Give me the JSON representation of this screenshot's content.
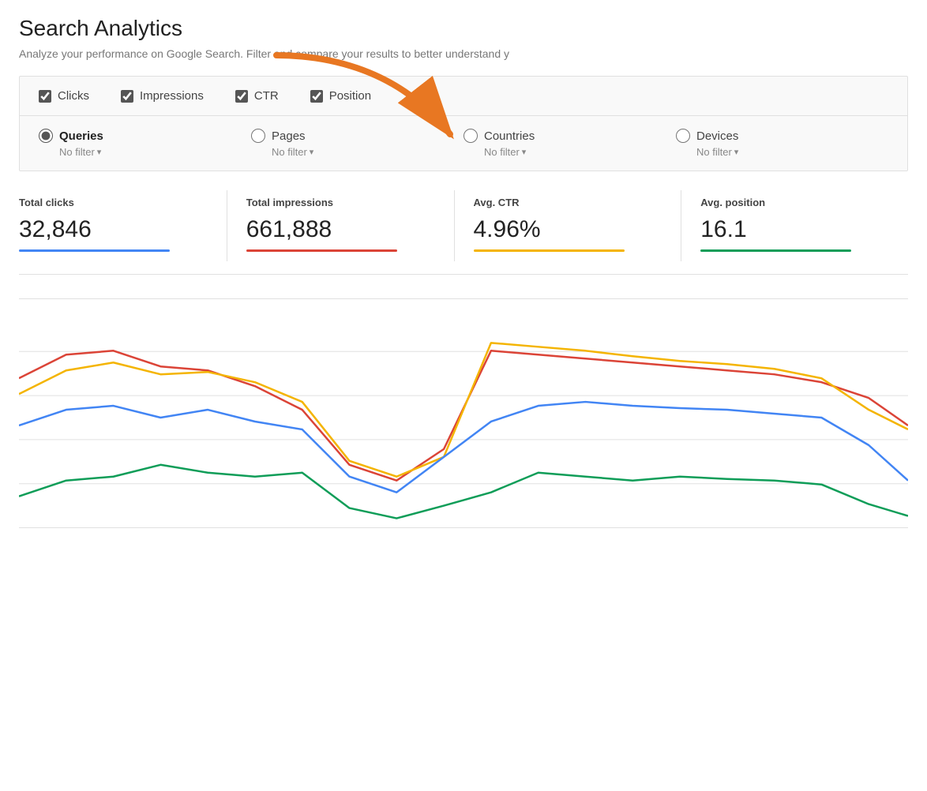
{
  "page": {
    "title": "Search Analytics",
    "subtitle": "Analyze your performance on Google Search. Filter and compare your results to better understand y"
  },
  "checkboxes": [
    {
      "id": "clicks",
      "label": "Clicks",
      "checked": true
    },
    {
      "id": "impressions",
      "label": "Impressions",
      "checked": true
    },
    {
      "id": "ctr",
      "label": "CTR",
      "checked": true
    },
    {
      "id": "position",
      "label": "Position",
      "checked": true
    }
  ],
  "radios": [
    {
      "id": "queries",
      "label": "Queries",
      "checked": true,
      "filter": "No filter"
    },
    {
      "id": "pages",
      "label": "Pages",
      "checked": false,
      "filter": "No filter"
    },
    {
      "id": "countries",
      "label": "Countries",
      "checked": false,
      "filter": "No filter"
    },
    {
      "id": "devices",
      "label": "Devices",
      "checked": false,
      "filter": "No filter"
    }
  ],
  "stats": [
    {
      "label": "Total clicks",
      "value": "32,846",
      "color_class": "blue"
    },
    {
      "label": "Total impressions",
      "value": "661,888",
      "color_class": "red"
    },
    {
      "label": "Avg. CTR",
      "value": "4.96%",
      "color_class": "orange"
    },
    {
      "label": "Avg. position",
      "value": "16.1",
      "color_class": "green"
    }
  ],
  "arrow": {
    "color": "#f5a623",
    "target": "CTR checkbox"
  }
}
